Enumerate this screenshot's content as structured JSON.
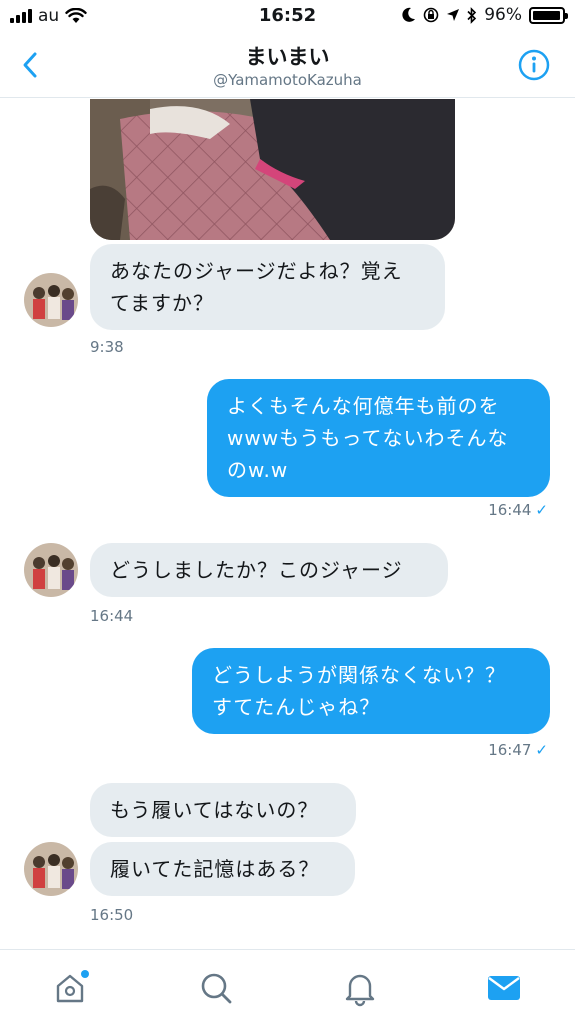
{
  "status_bar": {
    "carrier": "au",
    "time": "16:52",
    "battery_text": "96%",
    "battery_level": 0.96
  },
  "nav": {
    "title": "まいまい",
    "handle": "@YamamotoKazuha",
    "back_icon": "chevron-left-icon",
    "info_icon": "info-icon"
  },
  "colors": {
    "accent": "#1da1f2",
    "incoming_bubble": "#e6ecf0",
    "meta_text": "#657786"
  },
  "messages": [
    {
      "direction": "in",
      "type": "image"
    },
    {
      "direction": "in",
      "lines": [
        "あなたのジャージだよね？覚え",
        "てますか？"
      ]
    },
    {
      "direction": "in",
      "timestamp": "9:38"
    },
    {
      "direction": "out",
      "lines": [
        "よくもそんな何億年も前のを",
        "wwwもうもってないわそんな",
        "のw.w"
      ],
      "timestamp": "16:44",
      "status": "✓"
    },
    {
      "direction": "in",
      "lines": [
        "どうしましたか？このジャージ"
      ],
      "timestamp": "16:44"
    },
    {
      "direction": "out",
      "lines": [
        "どうしようが関係なくない？？",
        "すてたんじゃね？"
      ],
      "timestamp": "16:47",
      "status": "✓"
    },
    {
      "direction": "in",
      "lines": [
        "もう履いてはないの？"
      ]
    },
    {
      "direction": "in",
      "lines": [
        "履いてた記憶はある？"
      ],
      "timestamp": "16:50"
    }
  ],
  "tab_bar": {
    "items": [
      "home-icon",
      "search-icon",
      "notifications-icon",
      "messages-icon"
    ],
    "active": "messages-icon"
  }
}
